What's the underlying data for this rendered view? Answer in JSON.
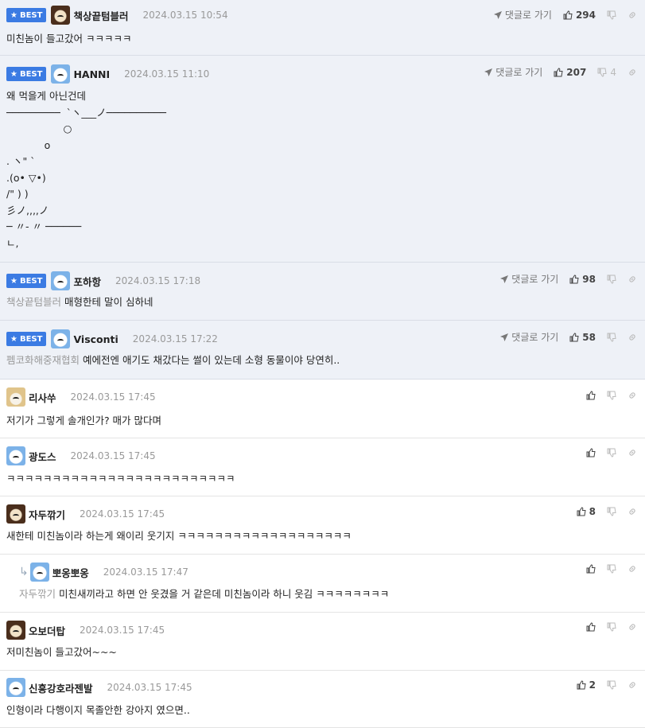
{
  "labels": {
    "best": "BEST",
    "reply_link": "댓글로 가기"
  },
  "comments": [
    {
      "nick": "책상끝텀블러",
      "date": "2024.03.15 10:54",
      "likes": "294",
      "dislikes": "",
      "text": "미친놈이 들고갔어 ㅋㅋㅋㅋㅋ",
      "mention": ""
    },
    {
      "nick": "HANNI",
      "date": "2024.03.15 11:10",
      "likes": "207",
      "dislikes": "4",
      "text": "왜 먹을게 아닌건데\n───────── ͏ ͏`ヽ___ノ──────────\n                  ○\n            o\n. ヽ\" `\n.(o• ▽•)\n/\" ) )\n彡ノ,,,,ノ\n─ 〃- 〃 ──────\nㄴ,",
      "mention": ""
    },
    {
      "nick": "포하항",
      "date": "2024.03.15 17:18",
      "likes": "98",
      "dislikes": "",
      "text": "매형한테 말이 심하네",
      "mention": "책상끝텀블러"
    },
    {
      "nick": "Visconti",
      "date": "2024.03.15 17:22",
      "likes": "58",
      "dislikes": "",
      "text": "예에전엔 애기도 채갔다는 썰이 있는데 소형 동물이야 당연히..",
      "mention": "펨코화해중재협회"
    },
    {
      "nick": "리사쑤",
      "date": "2024.03.15 17:45",
      "likes": "",
      "dislikes": "",
      "text": "저기가 그렇게 솔개인가? 매가 많다며",
      "mention": ""
    },
    {
      "nick": "광도스",
      "date": "2024.03.15 17:45",
      "likes": "",
      "dislikes": "",
      "text": "ㅋㅋㅋㅋㅋㅋㅋㅋㅋㅋㅋㅋㅋㅋㅋㅋㅋㅋㅋㅋㅋㅋㅋㅋㅋ",
      "mention": ""
    },
    {
      "nick": "자두깎기",
      "date": "2024.03.15 17:45",
      "likes": "8",
      "dislikes": "",
      "text": "새한테 미친놈이라 하는게 왜이리 웃기지 ㅋㅋㅋㅋㅋㅋㅋㅋㅋㅋㅋㅋㅋㅋㅋㅋㅋㅋㅋ",
      "mention": ""
    },
    {
      "nick": "뽀옹뽀옹",
      "date": "2024.03.15 17:47",
      "likes": "",
      "dislikes": "",
      "text": "미친새끼라고 하면 안 웃겼을 거 같은데 미친놈이라 하니 웃김 ㅋㅋㅋㅋㅋㅋㅋㅋ",
      "mention": "자두깎기"
    },
    {
      "nick": "오보더탑",
      "date": "2024.03.15 17:45",
      "likes": "",
      "dislikes": "",
      "text": "저미친놈이 들고갔어~~~",
      "mention": ""
    },
    {
      "nick": "신흥강호라젠발",
      "date": "2024.03.15 17:45",
      "likes": "2",
      "dislikes": "",
      "text": "인형이라 다행이지 목졸안한 강아지 였으면..",
      "mention": ""
    }
  ],
  "icons": {
    "star": "star-icon",
    "send": "send-arrow-icon",
    "thumb_up": "thumbs-up-icon",
    "thumb_down": "thumbs-down-icon",
    "link": "link-icon",
    "reply": "reply-arrow-icon"
  },
  "colors": {
    "best_badge": "#3b7be3",
    "best_bg": "#eef1f7",
    "mention": "#999999"
  }
}
